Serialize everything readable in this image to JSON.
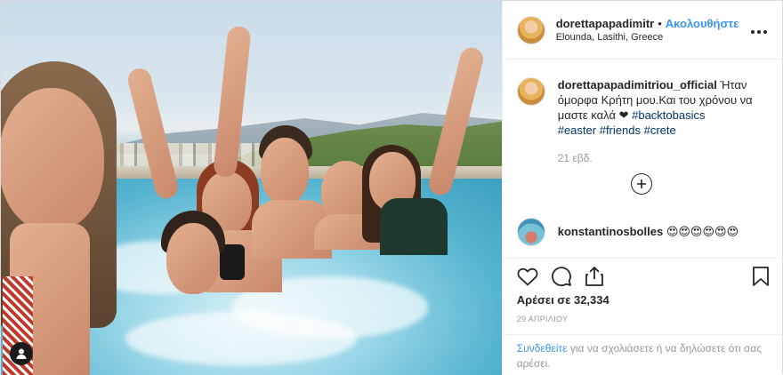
{
  "post": {
    "author": {
      "username": "dorettapapadimitr",
      "follow_label": "Ακολουθήστε",
      "location": "Elounda, Lasithi, Greece",
      "separator": "•"
    },
    "caption": {
      "username": "dorettapapadimitriou_official",
      "text": "Ήταν όμορφα Κρήτη μου.Και του χρόνου να μαστε καλά ❤",
      "hashtags": [
        "#backtobasics",
        "#easter",
        "#friends",
        "#crete"
      ]
    },
    "age": "21 εβδ.",
    "comments": [
      {
        "username": "konstantinosbolles",
        "text": "😍😍😍😍😍😍"
      }
    ],
    "likes_text": "Αρέσει σε 32,334",
    "date": "29 ΑΠΡΙΛΙΟΥ",
    "login_prompt": {
      "link_text": "Συνδεθείτε",
      "rest_text": " για να σχολιάσετε ή να δηλώσετε ότι σας αρέσει."
    }
  },
  "icons": {
    "more": "more-options-icon",
    "load_more": "add-circle-icon",
    "like": "heart-icon",
    "comment": "comment-bubble-icon",
    "share": "share-icon",
    "save": "bookmark-icon",
    "tagged": "tagged-user-icon"
  },
  "colors": {
    "link_blue": "#3897f0",
    "hashtag": "#003569",
    "muted": "#999999",
    "text": "#262626"
  }
}
